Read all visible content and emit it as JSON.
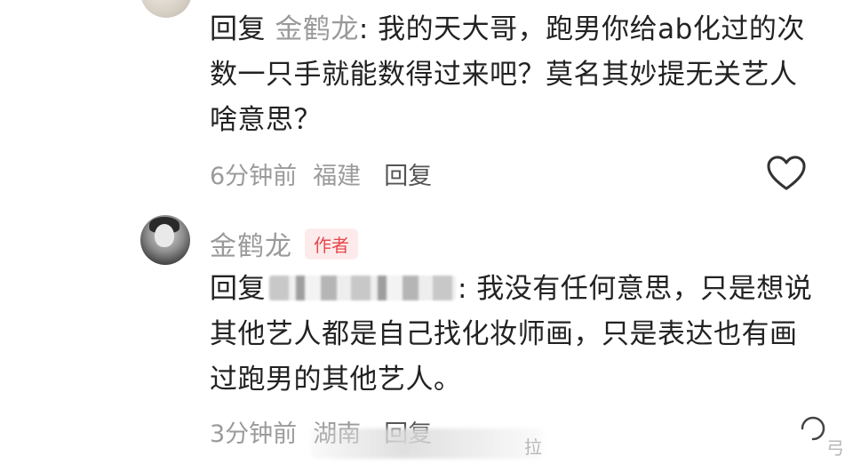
{
  "comments": [
    {
      "reply_prefix": "回复",
      "target_user": "金鹤龙",
      "text_after": ": 我的天大哥，跑男你给ab化过的次数一只手就能数得过来吧？莫名其妙提无关艺人啥意思？",
      "time": "6分钟前",
      "location": "福建",
      "reply_label": "回复"
    },
    {
      "author": "金鹤龙",
      "author_badge": "作者",
      "reply_prefix": "回复",
      "text_after": ": 我没有任何意思，只是想说其他艺人都是自己找化妆师画，只是表达也有画过跑男的其他艺人。",
      "time": "3分钟前",
      "location": "湖南",
      "reply_label": "回复"
    }
  ],
  "icons": {
    "like": "heart-outline-icon"
  },
  "watermark": {
    "text": "拉",
    "corner": "弓"
  },
  "colors": {
    "text": "#222222",
    "muted": "#9a9a9a",
    "badge_red": "#e8474a",
    "badge_bg": "#fdebec"
  }
}
